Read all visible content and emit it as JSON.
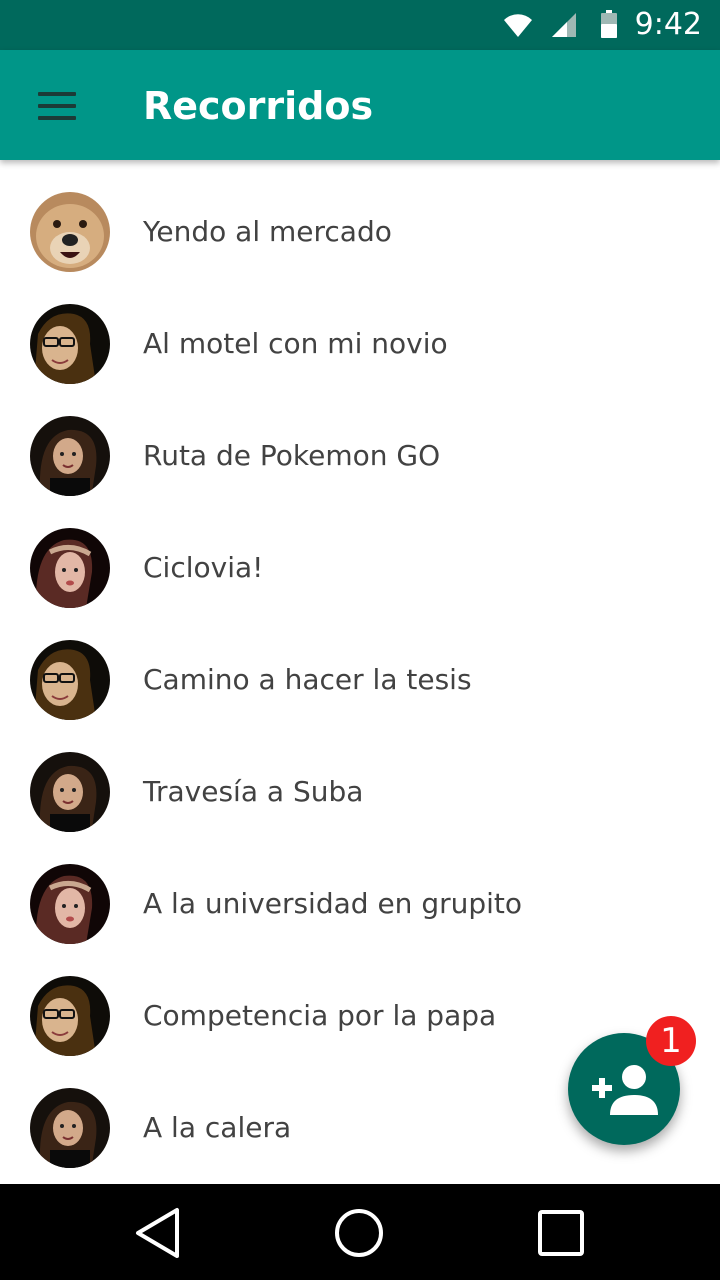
{
  "status_bar": {
    "time": "9:42",
    "icons": [
      "wifi-icon",
      "signal-icon",
      "battery-icon"
    ]
  },
  "app_bar": {
    "title": "Recorridos",
    "menu_icon": "menu-icon"
  },
  "colors": {
    "status_bar": "#00695c",
    "app_bar": "#009688",
    "fab": "#00695c",
    "badge": "#f02020",
    "text": "#424242"
  },
  "routes": [
    {
      "label": "Yendo al mercado",
      "avatar": "dog"
    },
    {
      "label": "Al motel con mi novio",
      "avatar": "woman-glasses"
    },
    {
      "label": "Ruta de Pokemon GO",
      "avatar": "woman-dark-hair"
    },
    {
      "label": "Ciclovia!",
      "avatar": "woman-headband"
    },
    {
      "label": "Camino a hacer la tesis",
      "avatar": "woman-glasses"
    },
    {
      "label": "Travesía a Suba",
      "avatar": "woman-dark-hair"
    },
    {
      "label": "A la universidad en grupito",
      "avatar": "woman-headband"
    },
    {
      "label": "Competencia por la papa",
      "avatar": "woman-glasses"
    },
    {
      "label": "A la calera",
      "avatar": "woman-dark-hair"
    }
  ],
  "fab": {
    "icon": "add-person-icon",
    "badge_count": "1"
  },
  "nav_bar": {
    "icons": [
      "back-icon",
      "home-icon",
      "recents-icon"
    ]
  }
}
